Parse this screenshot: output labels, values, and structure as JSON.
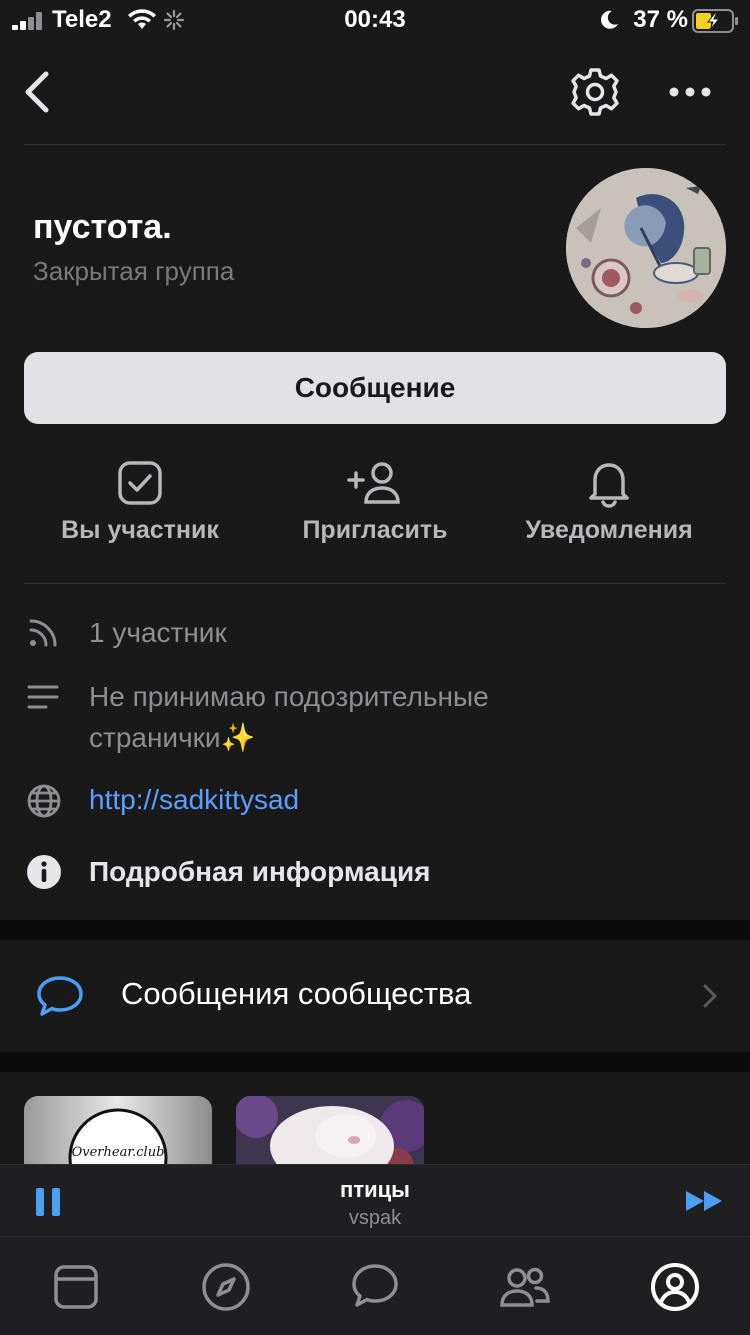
{
  "status_bar": {
    "carrier": "Tele2",
    "time": "00:43",
    "battery": "37 %"
  },
  "header": {
    "back_icon": "chevron-left-icon",
    "settings_icon": "gear-icon",
    "more_icon": "ellipsis-icon"
  },
  "group": {
    "name": "пустота.",
    "type": "Закрытая группа"
  },
  "message_button": "Сообщение",
  "actions": [
    {
      "label": "Вы участник",
      "icon": "checkbox-icon"
    },
    {
      "label": "Пригласить",
      "icon": "add-user-icon"
    },
    {
      "label": "Уведомления",
      "icon": "bell-icon"
    }
  ],
  "info": {
    "members": "1 участник",
    "description_line1": "Не принимаю подозрительные",
    "description_line2": "странички✨",
    "link": "http://sadkittysad",
    "details": "Подробная информация"
  },
  "community_messages": "Сообщения сообщества",
  "player": {
    "song": "птицы",
    "artist": "vspak"
  },
  "thumb_text": "Overhear.club",
  "colors": {
    "accent": "#5a9fff",
    "background": "#19191a",
    "button_bg": "#e2e2e6"
  }
}
